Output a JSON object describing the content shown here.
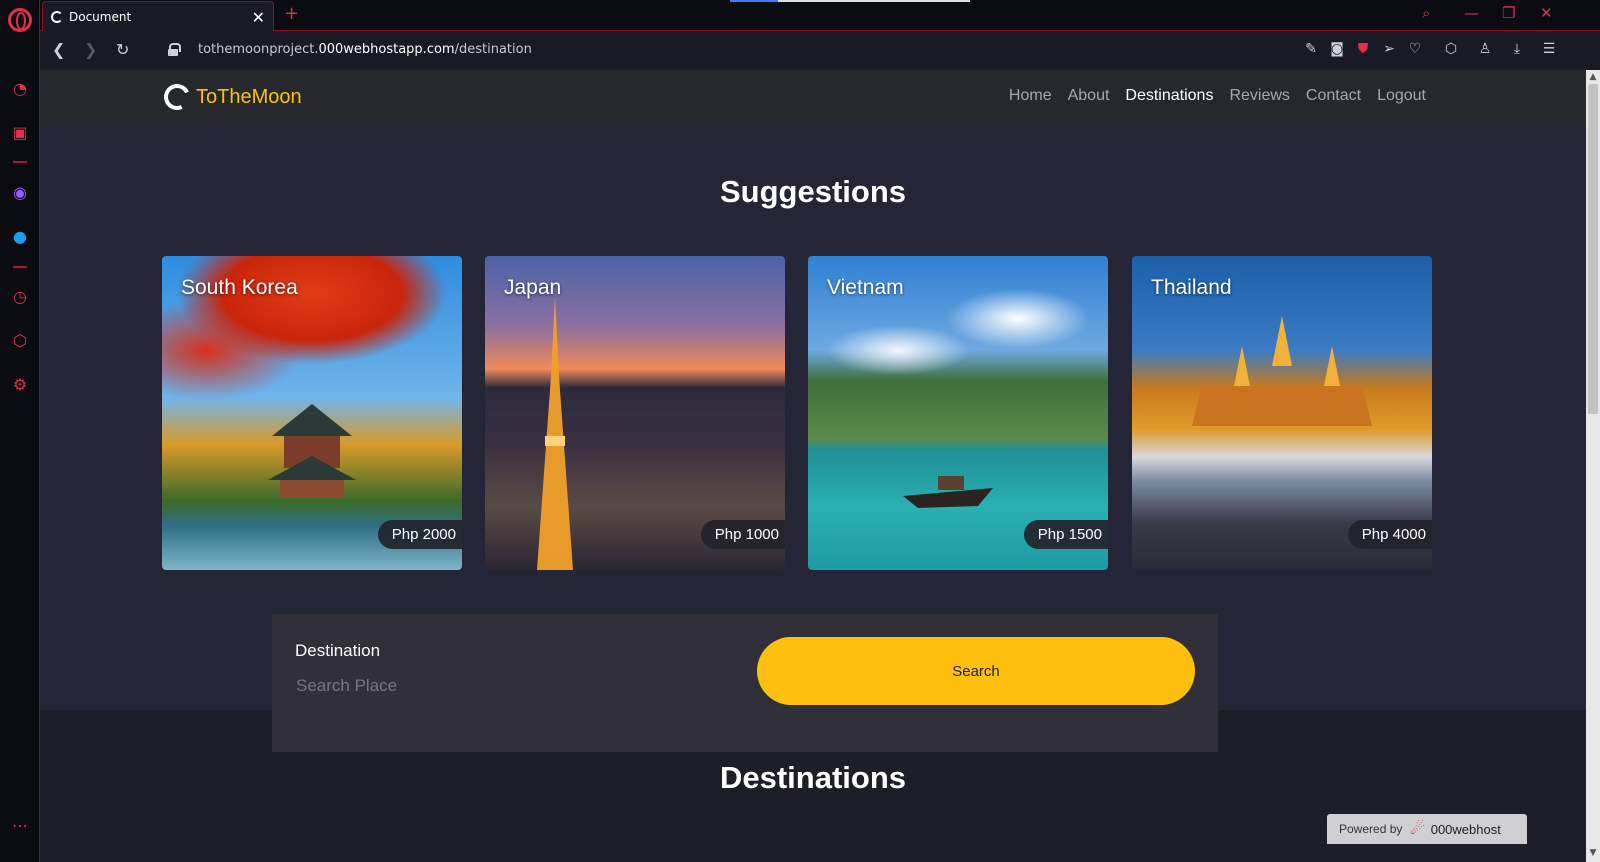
{
  "browser": {
    "tab_title": "Document",
    "url_prefix": "tothemoonproject.",
    "url_domain": "000webhostapp.com",
    "url_path": "/destination",
    "accent_color": "#e0304a"
  },
  "site": {
    "brand": "ToTheMoon",
    "brand_color": "#ffc107",
    "nav": [
      {
        "label": "Home"
      },
      {
        "label": "About"
      },
      {
        "label": "Destinations",
        "active": true
      },
      {
        "label": "Reviews"
      },
      {
        "label": "Contact"
      },
      {
        "label": "Logout"
      }
    ]
  },
  "suggestions": {
    "title": "Suggestions",
    "cards": [
      {
        "name": "South Korea",
        "price": "Php 2000"
      },
      {
        "name": "Japan",
        "price": "Php 1000"
      },
      {
        "name": "Vietnam",
        "price": "Php 1500"
      },
      {
        "name": "Thailand",
        "price": "Php 4000"
      }
    ]
  },
  "search": {
    "label": "Destination",
    "placeholder": "Search Place",
    "button": "Search",
    "button_color": "#ffbf0f"
  },
  "destinations": {
    "title": "Destinations"
  },
  "footer_badge": {
    "prefix": "Powered by",
    "host": "000webhost"
  }
}
